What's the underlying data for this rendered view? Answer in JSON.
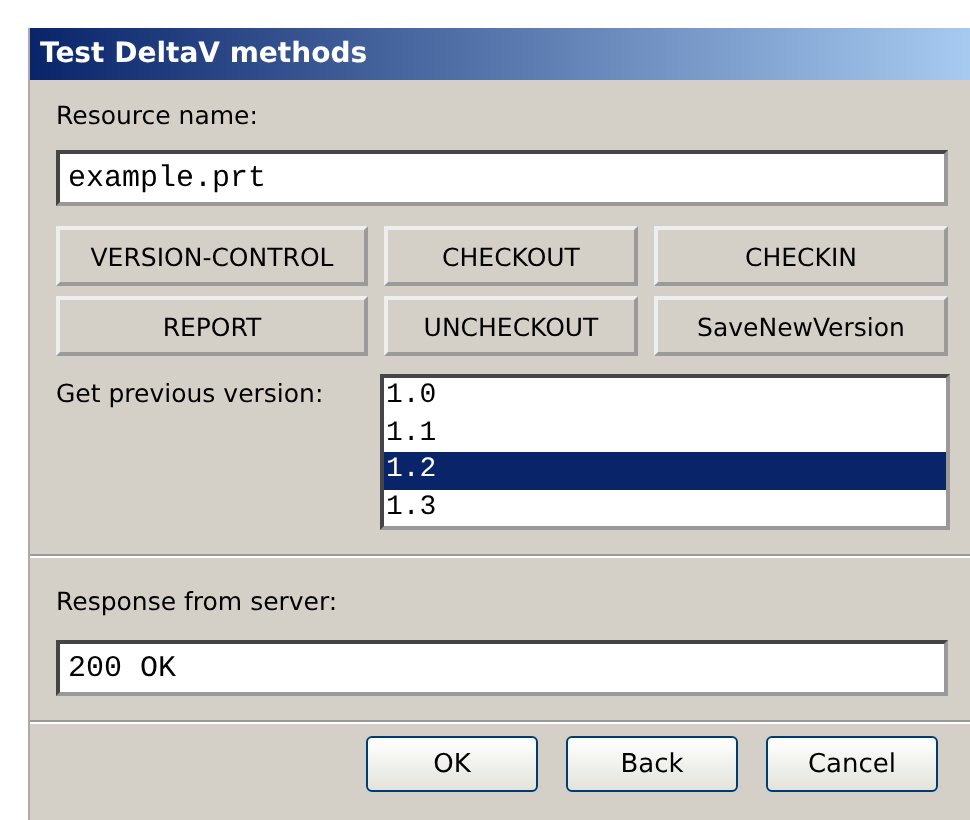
{
  "window": {
    "title": "Test DeltaV methods"
  },
  "resource": {
    "label": "Resource name:",
    "value": "example.prt"
  },
  "method_buttons": [
    "VERSION-CONTROL",
    "CHECKOUT",
    "CHECKIN",
    "REPORT",
    "UNCHECKOUT",
    "SaveNewVersion"
  ],
  "versions": {
    "label": "Get previous version:",
    "items": [
      {
        "label": "1.0",
        "selected": false
      },
      {
        "label": "1.1",
        "selected": false
      },
      {
        "label": "1.2",
        "selected": true
      },
      {
        "label": "1.3",
        "selected": false
      }
    ]
  },
  "response": {
    "label": "Response from server:",
    "value": "200 OK"
  },
  "buttons": [
    "OK",
    "Back",
    "Cancel"
  ]
}
